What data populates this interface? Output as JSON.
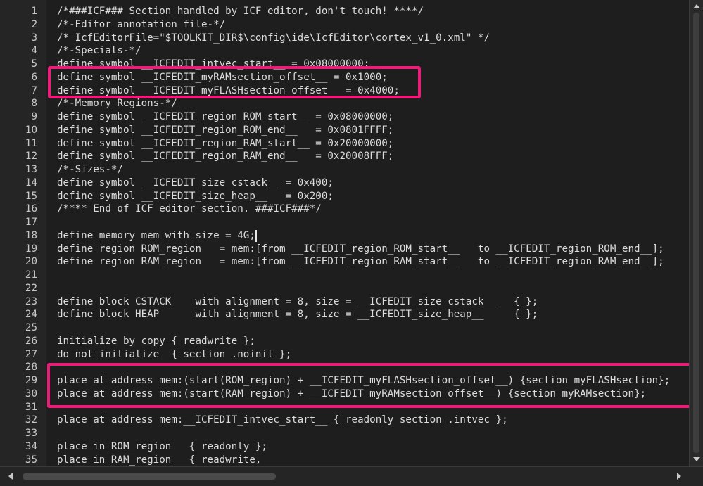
{
  "editor": {
    "colors": {
      "background": "#1e1e1e",
      "text": "#dcdcdc",
      "highlight": "#ec1c78"
    },
    "lines": [
      {
        "num": "1",
        "text": "/*###ICF### Section handled by ICF editor, don't touch! ****/"
      },
      {
        "num": "2",
        "text": "/*-Editor annotation file-*/"
      },
      {
        "num": "3",
        "text": "/* IcfEditorFile=\"$TOOLKIT_DIR$\\config\\ide\\IcfEditor\\cortex_v1_0.xml\" */"
      },
      {
        "num": "4",
        "text": "/*-Specials-*/"
      },
      {
        "num": "5",
        "text": "define symbol __ICFEDIT_intvec_start__ = 0x08000000;"
      },
      {
        "num": "6",
        "text": "define symbol __ICFEDIT_myRAMsection_offset__ = 0x1000;"
      },
      {
        "num": "7",
        "text": "define symbol __ICFEDIT_myFLASHsection_offset__ = 0x4000;"
      },
      {
        "num": "8",
        "text": "/*-Memory Regions-*/"
      },
      {
        "num": "9",
        "text": "define symbol __ICFEDIT_region_ROM_start__ = 0x08000000;"
      },
      {
        "num": "10",
        "text": "define symbol __ICFEDIT_region_ROM_end__   = 0x0801FFFF;"
      },
      {
        "num": "11",
        "text": "define symbol __ICFEDIT_region_RAM_start__ = 0x20000000;"
      },
      {
        "num": "12",
        "text": "define symbol __ICFEDIT_region_RAM_end__   = 0x20008FFF;"
      },
      {
        "num": "13",
        "text": "/*-Sizes-*/"
      },
      {
        "num": "14",
        "text": "define symbol __ICFEDIT_size_cstack__ = 0x400;"
      },
      {
        "num": "15",
        "text": "define symbol __ICFEDIT_size_heap__   = 0x200;"
      },
      {
        "num": "16",
        "text": "/**** End of ICF editor section. ###ICF###*/"
      },
      {
        "num": "17",
        "text": ""
      },
      {
        "num": "18",
        "text": "define memory mem with size = 4G;"
      },
      {
        "num": "19",
        "text": "define region ROM_region   = mem:[from __ICFEDIT_region_ROM_start__   to __ICFEDIT_region_ROM_end__];"
      },
      {
        "num": "20",
        "text": "define region RAM_region   = mem:[from __ICFEDIT_region_RAM_start__   to __ICFEDIT_region_RAM_end__];"
      },
      {
        "num": "21",
        "text": ""
      },
      {
        "num": "22",
        "text": ""
      },
      {
        "num": "23",
        "text": "define block CSTACK    with alignment = 8, size = __ICFEDIT_size_cstack__   { };"
      },
      {
        "num": "24",
        "text": "define block HEAP      with alignment = 8, size = __ICFEDIT_size_heap__     { };"
      },
      {
        "num": "25",
        "text": ""
      },
      {
        "num": "26",
        "text": "initialize by copy { readwrite };"
      },
      {
        "num": "27",
        "text": "do not initialize  { section .noinit };"
      },
      {
        "num": "28",
        "text": ""
      },
      {
        "num": "29",
        "text": "place at address mem:(start(ROM_region) + __ICFEDIT_myFLASHsection_offset__) {section myFLASHsection};"
      },
      {
        "num": "30",
        "text": "place at address mem:(start(RAM_region) + __ICFEDIT_myRAMsection_offset__) {section myRAMsection};"
      },
      {
        "num": "31",
        "text": ""
      },
      {
        "num": "32",
        "text": "place at address mem:__ICFEDIT_intvec_start__ { readonly section .intvec };"
      },
      {
        "num": "33",
        "text": ""
      },
      {
        "num": "34",
        "text": "place in ROM_region   { readonly };"
      },
      {
        "num": "35",
        "text": "place in RAM_region   { readwrite,"
      }
    ]
  }
}
